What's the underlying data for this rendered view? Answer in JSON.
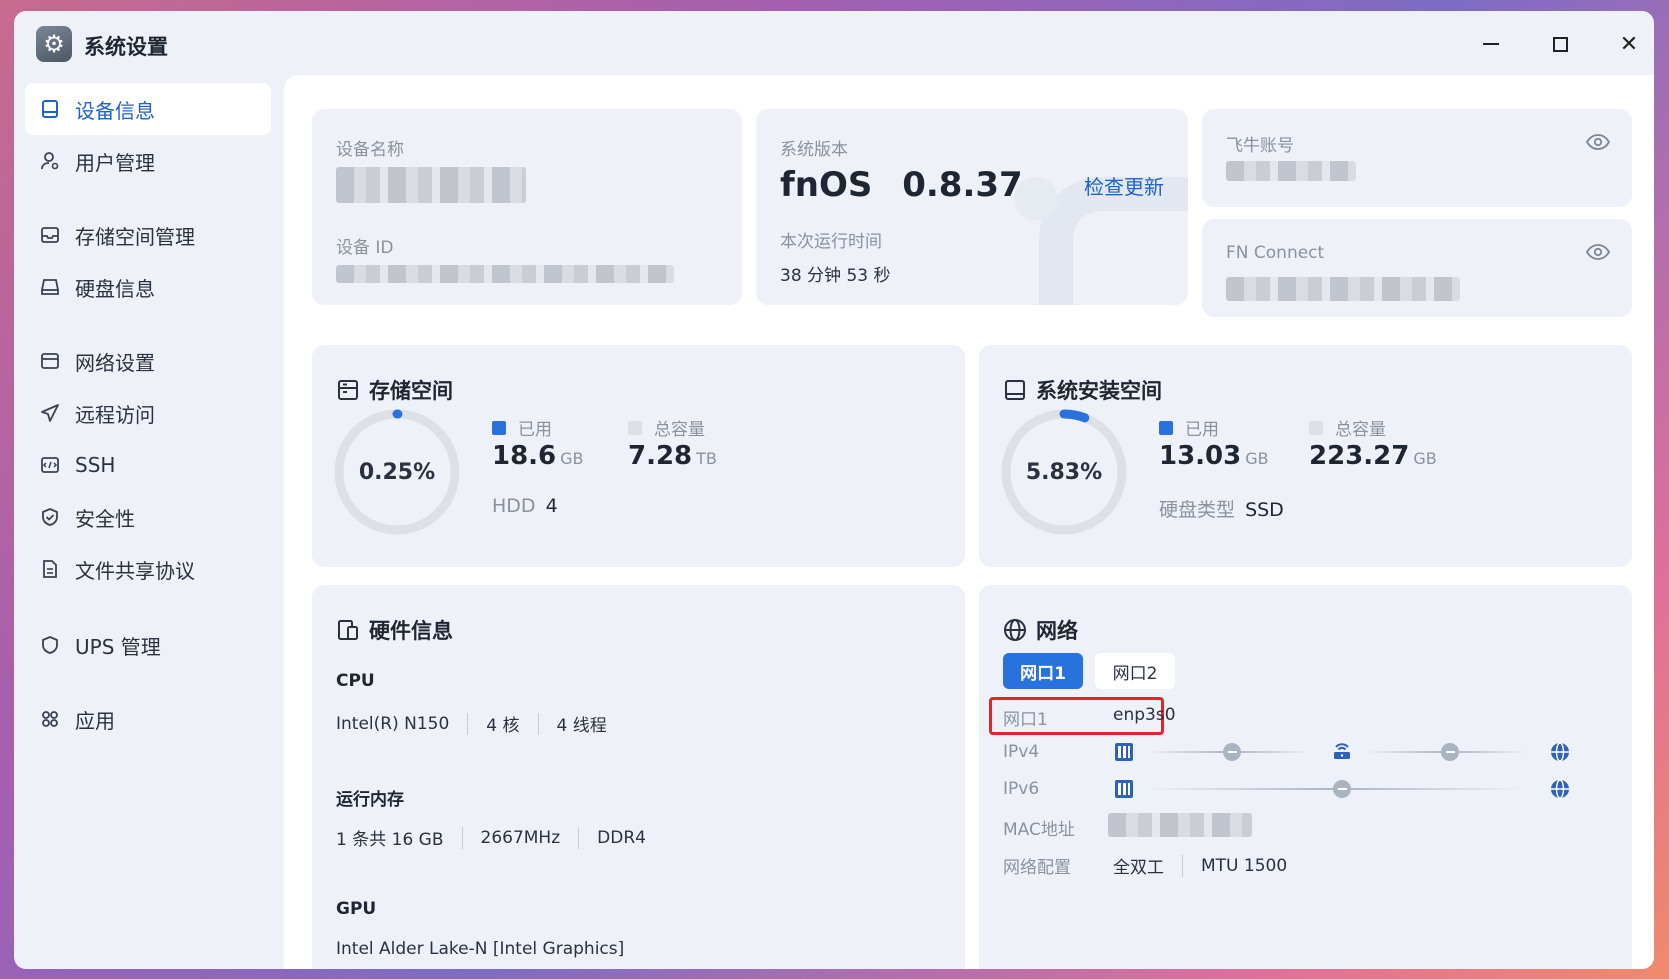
{
  "window": {
    "title": "系统设置"
  },
  "sidebar": {
    "items": [
      {
        "label": "设备信息",
        "icon": "device-icon",
        "active": true
      },
      {
        "label": "用户管理",
        "icon": "user-icon"
      },
      {
        "label": "存储空间管理",
        "icon": "storage-icon"
      },
      {
        "label": "硬盘信息",
        "icon": "disk-icon"
      },
      {
        "label": "网络设置",
        "icon": "network-icon"
      },
      {
        "label": "远程访问",
        "icon": "send-icon"
      },
      {
        "label": "SSH",
        "icon": "ssh-icon"
      },
      {
        "label": "安全性",
        "icon": "shield-check-icon"
      },
      {
        "label": "文件共享协议",
        "icon": "file-share-icon"
      },
      {
        "label": "UPS 管理",
        "icon": "shield-icon"
      },
      {
        "label": "应用",
        "icon": "apps-icon"
      }
    ]
  },
  "device": {
    "name_label": "设备名称",
    "id_label": "设备 ID"
  },
  "system": {
    "version_label": "系统版本",
    "os_name": "fnOS",
    "version": "0.8.37",
    "check_update": "检查更新",
    "uptime_label": "本次运行时间",
    "uptime": "38 分钟 53 秒"
  },
  "account": {
    "label": "飞牛账号"
  },
  "fnconnect": {
    "label": "FN Connect"
  },
  "storage": {
    "title": "存储空间",
    "percent": "0.25%",
    "percent_value": 0.25,
    "used_label": "已用",
    "used_value": "18.6",
    "used_unit": "GB",
    "total_label": "总容量",
    "total_value": "7.28",
    "total_unit": "TB",
    "disk_type_label": "HDD",
    "disk_count": "4"
  },
  "install": {
    "title": "系统安装空间",
    "percent": "5.83%",
    "percent_value": 5.83,
    "used_label": "已用",
    "used_value": "13.03",
    "used_unit": "GB",
    "total_label": "总容量",
    "total_value": "223.27",
    "total_unit": "GB",
    "disk_type_label": "硬盘类型",
    "disk_type": "SSD"
  },
  "hardware": {
    "title": "硬件信息",
    "cpu_label": "CPU",
    "cpu_model": "Intel(R) N150",
    "cpu_cores": "4 核",
    "cpu_threads": "4 线程",
    "mem_label": "运行内存",
    "mem_size": "1 条共 16 GB",
    "mem_freq": "2667MHz",
    "mem_type": "DDR4",
    "gpu_label": "GPU",
    "gpu_model": "Intel Alder Lake-N [Intel Graphics]"
  },
  "network": {
    "title": "网络",
    "tabs": [
      "网口1",
      "网口2"
    ],
    "port_label": "网口1",
    "port_value": "enp3s0",
    "ipv4_label": "IPv4",
    "ipv6_label": "IPv6",
    "mac_label": "MAC地址",
    "config_label": "网络配置",
    "duplex": "全双工",
    "mtu": "MTU 1500"
  },
  "colors": {
    "accent": "#2872dd",
    "ring_track": "#dde1e7",
    "highlight": "#e5232b"
  }
}
